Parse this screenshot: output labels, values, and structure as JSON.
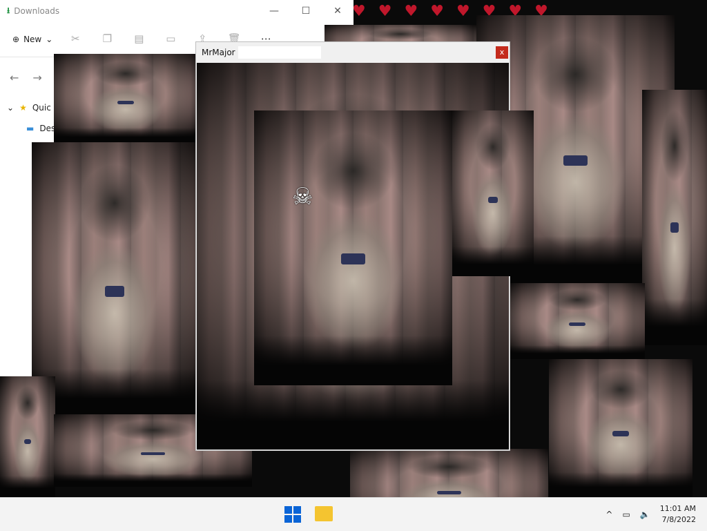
{
  "explorer": {
    "title": "Downloads",
    "title_icon": "download-icon",
    "window_controls": [
      "—",
      "☐",
      "✕"
    ],
    "toolbar": {
      "new_label": "New"
    },
    "tree": [
      {
        "label": "Quic",
        "icon": "star-icon"
      },
      {
        "label": "Des",
        "icon": "desktop-icon"
      }
    ]
  },
  "popup": {
    "title": "MrMajor",
    "close_label": "x"
  },
  "cursor": {
    "icon": "skull-crossbones-icon",
    "glyph": "☠"
  },
  "taskbar": {
    "time": "11:01 AM",
    "date": "7/8/2022",
    "tray_chevron": "^"
  },
  "colors": {
    "accent": "#0a64d6",
    "close_red": "#c42b1c",
    "heart_red": "#c0172b"
  }
}
